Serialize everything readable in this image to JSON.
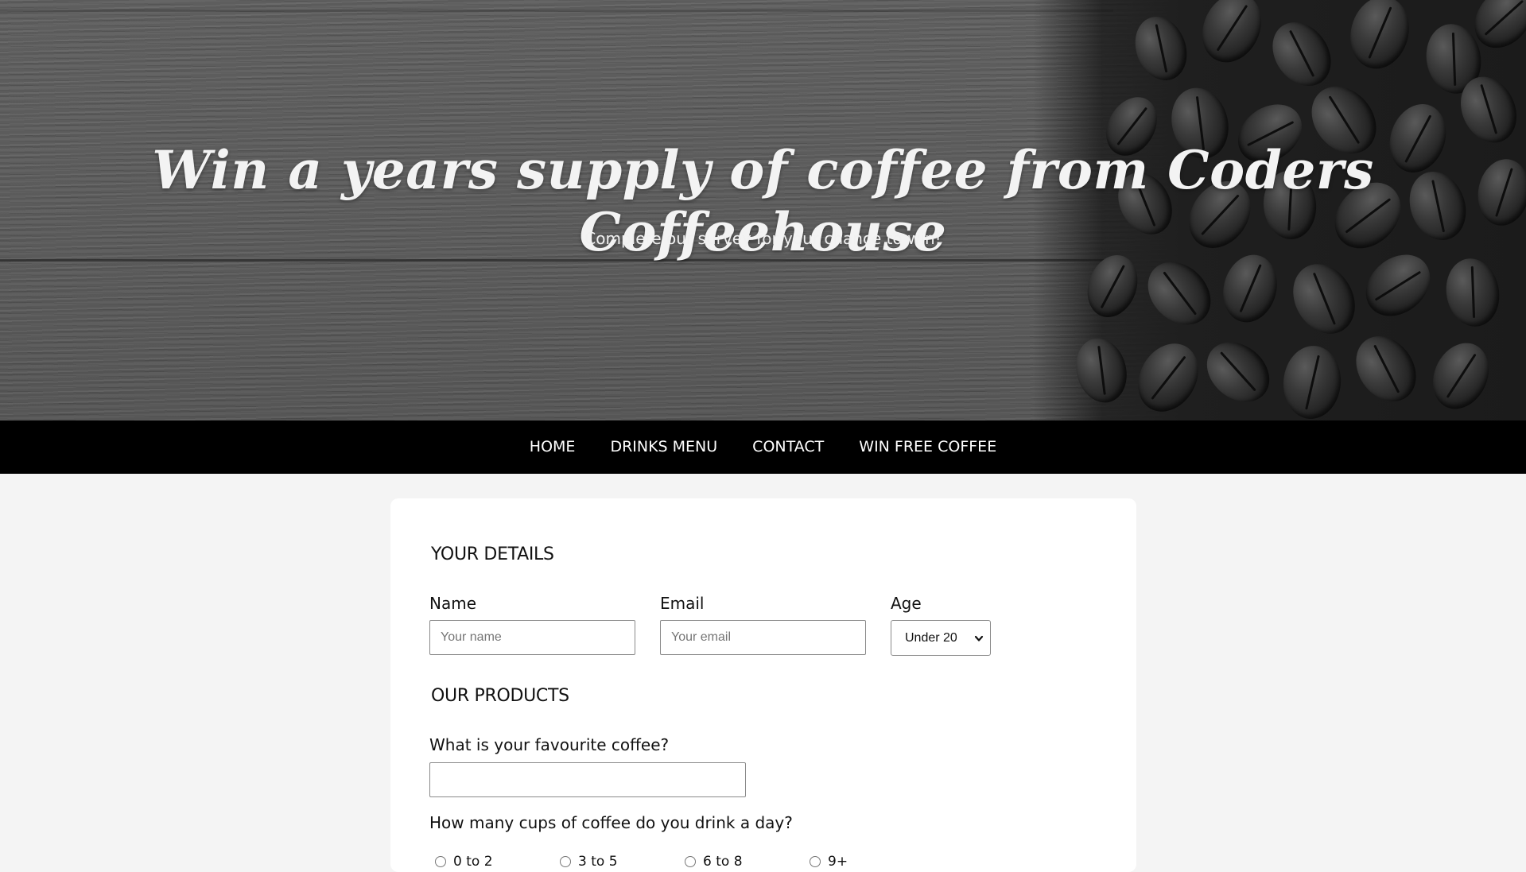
{
  "hero": {
    "title": "Win a years supply of coffee from Coders Coffeehouse",
    "subtitle": "Complete our survey for your chance to win!"
  },
  "nav": {
    "items": [
      {
        "label": "HOME"
      },
      {
        "label": "DRINKS MENU"
      },
      {
        "label": "CONTACT"
      },
      {
        "label": "WIN FREE COFFEE"
      }
    ]
  },
  "form": {
    "details": {
      "heading": "YOUR DETAILS",
      "name_label": "Name",
      "name_placeholder": "Your name",
      "email_label": "Email",
      "email_placeholder": "Your email",
      "age_label": "Age",
      "age_selected": "Under 20"
    },
    "products": {
      "heading": "OUR PRODUCTS",
      "favourite_label": "What is your favourite coffee?",
      "favourite_value": "",
      "cups_label": "How many cups of coffee do you drink a day?",
      "cups_options": [
        {
          "label": "0 to 2"
        },
        {
          "label": "3 to 5"
        },
        {
          "label": "6 to 8"
        },
        {
          "label": "9+"
        }
      ]
    }
  },
  "icons": {
    "age_select_chevron": "chevron-down-icon"
  },
  "colors": {
    "nav_background": "#000000",
    "page_background": "#f4f4f4",
    "card_background": "#ffffff",
    "hero_text": "#f3f3f3"
  }
}
